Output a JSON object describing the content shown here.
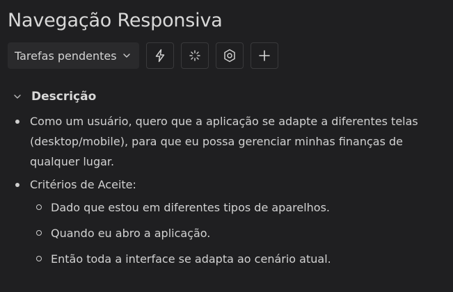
{
  "page": {
    "title": "Navegação Responsiva"
  },
  "toolbar": {
    "status_label": "Tarefas pendentes",
    "icons": [
      "lightning-icon",
      "loading-spinner-icon",
      "hexagon-settings-icon",
      "plus-icon"
    ]
  },
  "description": {
    "title": "Descrição",
    "items": [
      {
        "text": "Como um usuário, quero que a aplicação se adapte a diferentes telas (desktop/mobile), para que eu possa gerenciar minhas finanças de qualquer lugar."
      },
      {
        "text": "Critérios de Aceite:",
        "subitems": [
          "Dado que estou em diferentes tipos de aparelhos.",
          "Quando eu abro a aplicação.",
          "Então toda a interface se adapta ao cenário atual."
        ]
      }
    ]
  }
}
